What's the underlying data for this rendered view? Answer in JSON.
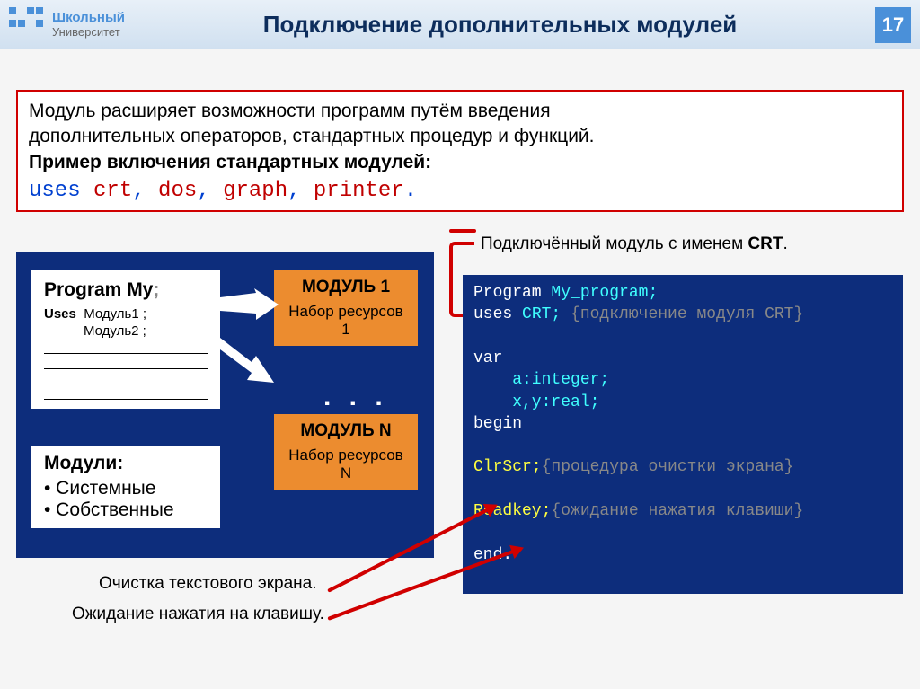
{
  "header": {
    "logo_top": "Школьный",
    "logo_bottom": "Университет",
    "title": "Подключение дополнительных модулей",
    "page_num": "17"
  },
  "intro": {
    "line1": "Модуль расширяет возможности программ путём введения",
    "line2": "дополнительных операторов, стандартных процедур и функций.",
    "line3": "Пример включения стандартных модулей:",
    "uses_kw": "uses",
    "mod1": "crt",
    "mod2": "dos",
    "mod3": "graph",
    "mod4": "printer",
    "comma": ", ",
    "period": "."
  },
  "crt_label": {
    "text": "Подключённый модуль с именем ",
    "bold": "CRT"
  },
  "program_card": {
    "title": "Program My",
    "semicolon": ";",
    "uses": "Uses",
    "m1": "Модуль1 ;",
    "m2": "Модуль2 ;"
  },
  "modules_card": {
    "title": "Модули:",
    "item1": "• Системные",
    "item2": "• Собственные"
  },
  "orange1": {
    "title": "МОДУЛЬ 1",
    "sub": "Набор ресурсов 1"
  },
  "orangen": {
    "title": "МОДУЛЬ N",
    "sub": "Набор ресурсов N"
  },
  "dots": ". . .",
  "caption1": "Очистка текстового экрана.",
  "caption2": "Ожидание нажатия на клавишу.",
  "code": {
    "l1a": "Program ",
    "l1b": "My_program;",
    "l2a": "uses ",
    "l2b": "CRT; ",
    "l2c": "{подключение модуля CRT}",
    "l4a": "var",
    "l5": "    a:integer;",
    "l6": "    x,y:real;",
    "l7a": "begin",
    "l9a": "ClrScr;",
    "l9b": "{процедура очистки экрана}",
    "l11a": "Readkey;",
    "l11b": "{ожидание нажатия клавиши}",
    "l13a": "end."
  }
}
